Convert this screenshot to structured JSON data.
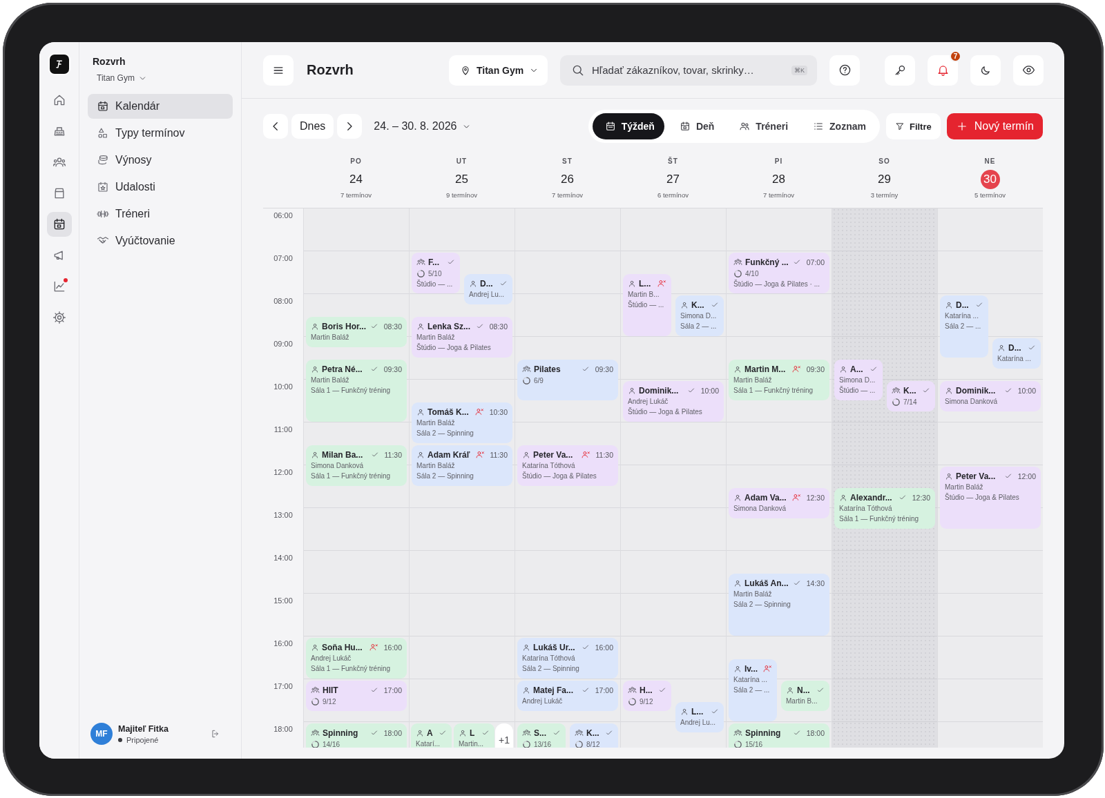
{
  "rail": {
    "items": [
      {
        "selected": false,
        "badge": false
      },
      {
        "selected": false,
        "badge": false
      },
      {
        "selected": false,
        "badge": false
      },
      {
        "selected": false,
        "badge": false
      },
      {
        "selected": true,
        "badge": false
      },
      {
        "selected": false,
        "badge": false
      },
      {
        "selected": false,
        "badge": true
      },
      {
        "selected": false,
        "badge": false
      }
    ]
  },
  "sidebar": {
    "title": "Rozvrh",
    "subtitle": "Titan Gym",
    "items": [
      {
        "label": "Kalendár",
        "selected": true
      },
      {
        "label": "Typy termínov",
        "selected": false
      },
      {
        "label": "Výnosy",
        "selected": false
      },
      {
        "label": "Udalosti",
        "selected": false
      },
      {
        "label": "Tréneri",
        "selected": false
      },
      {
        "label": "Vyúčtovanie",
        "selected": false
      }
    ],
    "user": {
      "initials": "MF",
      "name": "Majiteľ Fitka",
      "status": "Pripojené"
    }
  },
  "topbar": {
    "title": "Rozvrh",
    "location": "Titan Gym",
    "search": {
      "placeholder": "Hľadať zákazníkov, tovar, skrinky…",
      "shortcut": "⌘K"
    },
    "notifications": "7"
  },
  "toolbar": {
    "today": "Dnes",
    "range": "24. – 30. 8. 2026",
    "views": [
      {
        "label": "Týždeň",
        "selected": true
      },
      {
        "label": "Deň",
        "selected": false
      },
      {
        "label": "Tréneri",
        "selected": false
      },
      {
        "label": "Zoznam",
        "selected": false
      }
    ],
    "filter": "Filtre",
    "new": "Nový termín"
  },
  "calendar": {
    "hours": [
      "06:00",
      "07:00",
      "08:00",
      "09:00",
      "10:00",
      "11:00",
      "12:00",
      "13:00",
      "14:00",
      "15:00",
      "16:00",
      "17:00",
      "18:00"
    ],
    "days": [
      {
        "weekday": "PO",
        "date": "24",
        "count": "7 termínov",
        "today": false,
        "shaded": false,
        "slots": {
          "08:30": [
            {
              "kind": "individual",
              "title": "Boris Hor...",
              "no_show": false,
              "time": "08:30",
              "trainer": "Martin Baláž",
              "short": true,
              "long": false,
              "color": "#d6f2e0"
            }
          ],
          "09:30": [
            {
              "kind": "individual",
              "title": "Petra Né...",
              "no_show": false,
              "time": "09:30",
              "trainer": "Martin Baláž",
              "room": "Sála 1 — Funkčný tréning",
              "short": false,
              "long": true,
              "color": "#d6f2e0"
            }
          ],
          "11:30": [
            {
              "kind": "individual",
              "title": "Milan Ba...",
              "no_show": false,
              "time": "11:30",
              "trainer": "Simona Danková",
              "room": "Sála 1 — Funkčný tréning",
              "short": false,
              "long": false,
              "color": "#d6f2e0"
            }
          ],
          "16:00": [
            {
              "kind": "individual",
              "title": "Soňa Hu...",
              "no_show": true,
              "time": "16:00",
              "trainer": "Andrej Lukáč",
              "room": "Sála 1 — Funkčný tréning",
              "short": false,
              "long": false,
              "color": "#d6f2e0"
            }
          ],
          "17:00": [
            {
              "kind": "group",
              "title": "HIIT",
              "no_show": false,
              "time": "17:00",
              "capacity": "9/12",
              "short": true,
              "long": false,
              "color": "#ecdffa"
            }
          ],
          "18:00": [
            {
              "kind": "group",
              "title": "Spinning",
              "no_show": false,
              "time": "18:00",
              "capacity": "14/16",
              "short": false,
              "long": false,
              "color": "#d6f2e0"
            }
          ]
        }
      },
      {
        "weekday": "UT",
        "date": "25",
        "count": "9 termínov",
        "today": false,
        "shaded": false,
        "slots": {
          "07:00": [
            {
              "kind": "group",
              "title": "F...",
              "no_show": false,
              "capacity": "5/10",
              "room": "Štúdio — ...",
              "short": false,
              "long": false,
              "color": "#ecdffa"
            }
          ],
          "07:30": [
            {
              "kind": "individual",
              "title": "D...",
              "no_show": false,
              "trainer": "Andrej Lu...",
              "short": true,
              "long": false,
              "color": "#dbe6fb"
            }
          ],
          "08:30": [
            {
              "kind": "individual",
              "title": "Lenka Sz...",
              "no_show": false,
              "time": "08:30",
              "trainer": "Martin Baláž",
              "room": "Štúdio — Joga & Pilates",
              "short": false,
              "long": false,
              "color": "#ecdffa"
            }
          ],
          "10:30": [
            {
              "kind": "individual",
              "title": "Tomáš K...",
              "no_show": true,
              "time": "10:30",
              "trainer": "Martin Baláž",
              "room": "Sála 2 — Spinning",
              "short": false,
              "long": false,
              "color": "#dbe6fb"
            }
          ],
          "11:30": [
            {
              "kind": "individual",
              "title": "Adam Kráľ",
              "no_show": true,
              "time": "11:30",
              "trainer": "Martin Baláž",
              "room": "Sála 2 — Spinning",
              "short": false,
              "long": false,
              "color": "#dbe6fb"
            }
          ],
          "18:00": [
            {
              "kind": "individual",
              "title": "A",
              "no_show": false,
              "trainer": "Katarí...",
              "short": false,
              "long": false,
              "color": "#d6f2e0"
            },
            {
              "kind": "individual",
              "title": "L",
              "no_show": false,
              "trainer": "Martin...",
              "short": false,
              "long": false,
              "color": "#d6f2e0"
            },
            {
              "kind": "more",
              "label": "+1"
            }
          ]
        }
      },
      {
        "weekday": "ST",
        "date": "26",
        "count": "7 termínov",
        "today": false,
        "shaded": false,
        "slots": {
          "09:30": [
            {
              "kind": "group",
              "title": "Pilates",
              "no_show": false,
              "time": "09:30",
              "capacity": "6/9",
              "short": false,
              "long": false,
              "color": "#dbe6fb"
            }
          ],
          "11:30": [
            {
              "kind": "individual",
              "title": "Peter Va...",
              "no_show": true,
              "time": "11:30",
              "trainer": "Katarína Tóthová",
              "room": "Štúdio — Joga & Pilates",
              "short": false,
              "long": false,
              "color": "#ecdffa"
            }
          ],
          "16:00": [
            {
              "kind": "individual",
              "title": "Lukáš Ur...",
              "no_show": false,
              "time": "16:00",
              "trainer": "Katarína Tóthová",
              "room": "Sála 2 — Spinning",
              "short": false,
              "long": false,
              "color": "#dbe6fb"
            }
          ],
          "17:00": [
            {
              "kind": "individual",
              "title": "Matej Fa...",
              "no_show": false,
              "time": "17:00",
              "trainer": "Andrej Lukáč",
              "short": true,
              "long": false,
              "color": "#dbe6fb"
            }
          ],
          "18:00": [
            {
              "kind": "group",
              "title": "S...",
              "no_show": false,
              "capacity": "13/16",
              "short": false,
              "long": false,
              "color": "#d6f2e0"
            },
            {
              "kind": "group",
              "title": "K...",
              "no_show": false,
              "capacity": "8/12",
              "short": false,
              "long": false,
              "color": "#dbe6fb"
            }
          ]
        }
      },
      {
        "weekday": "ŠT",
        "date": "27",
        "count": "6 termínov",
        "today": false,
        "shaded": false,
        "slots": {
          "07:30": [
            {
              "kind": "individual",
              "title": "L...",
              "no_show": true,
              "trainer": "Martin B...",
              "room": "Štúdio — ...",
              "short": false,
              "long": true,
              "color": "#ecdffa"
            }
          ],
          "08:00": [
            {
              "kind": "individual",
              "title": "K...",
              "no_show": false,
              "trainer": "Simona D...",
              "room": "Sála 2 — ...",
              "short": false,
              "long": false,
              "color": "#dbe6fb"
            }
          ],
          "10:00": [
            {
              "kind": "individual",
              "title": "Dominik...",
              "no_show": false,
              "time": "10:00",
              "trainer": "Andrej Lukáč",
              "room": "Štúdio — Joga & Pilates",
              "short": false,
              "long": false,
              "color": "#ecdffa"
            }
          ],
          "17:00": [
            {
              "kind": "group",
              "title": "H...",
              "no_show": false,
              "capacity": "9/12",
              "short": true,
              "long": false,
              "color": "#ecdffa"
            }
          ],
          "17:30": [
            {
              "kind": "individual",
              "title": "L...",
              "no_show": false,
              "trainer": "Andrej Lu...",
              "short": true,
              "long": false,
              "color": "#dbe6fb"
            }
          ]
        }
      },
      {
        "weekday": "PI",
        "date": "28",
        "count": "7 termínov",
        "today": false,
        "shaded": false,
        "slots": {
          "07:00": [
            {
              "kind": "group",
              "title": "Funkčný ...",
              "no_show": false,
              "time": "07:00",
              "capacity": "4/10",
              "room": "Štúdio — Joga & Pilates · ...",
              "short": false,
              "long": false,
              "color": "#ecdffa"
            }
          ],
          "09:30": [
            {
              "kind": "individual",
              "title": "Martin M...",
              "no_show": true,
              "time": "09:30",
              "trainer": "Martin Baláž",
              "room": "Sála 1 — Funkčný tréning",
              "short": false,
              "long": false,
              "color": "#d6f2e0"
            }
          ],
          "12:30": [
            {
              "kind": "individual",
              "title": "Adam Va...",
              "no_show": true,
              "time": "12:30",
              "trainer": "Simona Danková",
              "short": true,
              "long": false,
              "color": "#ecdffa"
            }
          ],
          "14:30": [
            {
              "kind": "individual",
              "title": "Lukáš An...",
              "no_show": false,
              "time": "14:30",
              "trainer": "Martin Baláž",
              "room": "Sála 2 — Spinning",
              "short": false,
              "long": true,
              "color": "#dbe6fb"
            }
          ],
          "16:30": [
            {
              "kind": "individual",
              "title": "Iv...",
              "no_show": true,
              "trainer": "Katarína ...",
              "room": "Sála 2 — ...",
              "short": false,
              "long": true,
              "color": "#dbe6fb"
            }
          ],
          "17:00": [
            {
              "kind": "individual",
              "title": "N...",
              "no_show": false,
              "trainer": "Martin B...",
              "short": true,
              "long": false,
              "color": "#d6f2e0"
            }
          ],
          "18:00": [
            {
              "kind": "group",
              "title": "Spinning",
              "no_show": false,
              "time": "18:00",
              "capacity": "15/16",
              "short": false,
              "long": false,
              "color": "#d6f2e0"
            }
          ]
        }
      },
      {
        "weekday": "SO",
        "date": "29",
        "count": "3 termíny",
        "today": false,
        "shaded": true,
        "slots": {
          "09:30": [
            {
              "kind": "individual",
              "title": "A...",
              "no_show": false,
              "trainer": "Simona D...",
              "room": "Štúdio — ...",
              "short": false,
              "long": false,
              "color": "#ecdffa"
            }
          ],
          "10:00": [
            {
              "kind": "group",
              "title": "K...",
              "no_show": false,
              "capacity": "7/14",
              "short": true,
              "long": false,
              "color": "#ecdffa"
            }
          ],
          "12:30": [
            {
              "kind": "individual",
              "title": "Alexandr...",
              "no_show": false,
              "time": "12:30",
              "trainer": "Katarína Tóthová",
              "room": "Sála 1 — Funkčný tréning",
              "short": false,
              "long": false,
              "color": "#d6f2e0"
            }
          ]
        }
      },
      {
        "weekday": "NE",
        "date": "30",
        "count": "5 termínov",
        "today": true,
        "shaded": false,
        "slots": {
          "08:00": [
            {
              "kind": "individual",
              "title": "D...",
              "no_show": false,
              "trainer": "Katarína ...",
              "room": "Sála 2 — ...",
              "short": false,
              "long": true,
              "color": "#dbe6fb"
            }
          ],
          "09:00": [
            {
              "kind": "individual",
              "title": "D...",
              "no_show": false,
              "trainer": "Katarína ...",
              "short": true,
              "long": false,
              "color": "#dbe6fb"
            }
          ],
          "10:00": [
            {
              "kind": "individual",
              "title": "Dominik...",
              "no_show": false,
              "time": "10:00",
              "trainer": "Simona Danková",
              "short": true,
              "long": false,
              "color": "#ecdffa"
            }
          ],
          "12:00": [
            {
              "kind": "individual",
              "title": "Peter Va...",
              "no_show": false,
              "time": "12:00",
              "trainer": "Martin Baláž",
              "room": "Štúdio — Joga & Pilates",
              "short": false,
              "long": true,
              "color": "#ecdffa"
            }
          ]
        }
      }
    ]
  }
}
